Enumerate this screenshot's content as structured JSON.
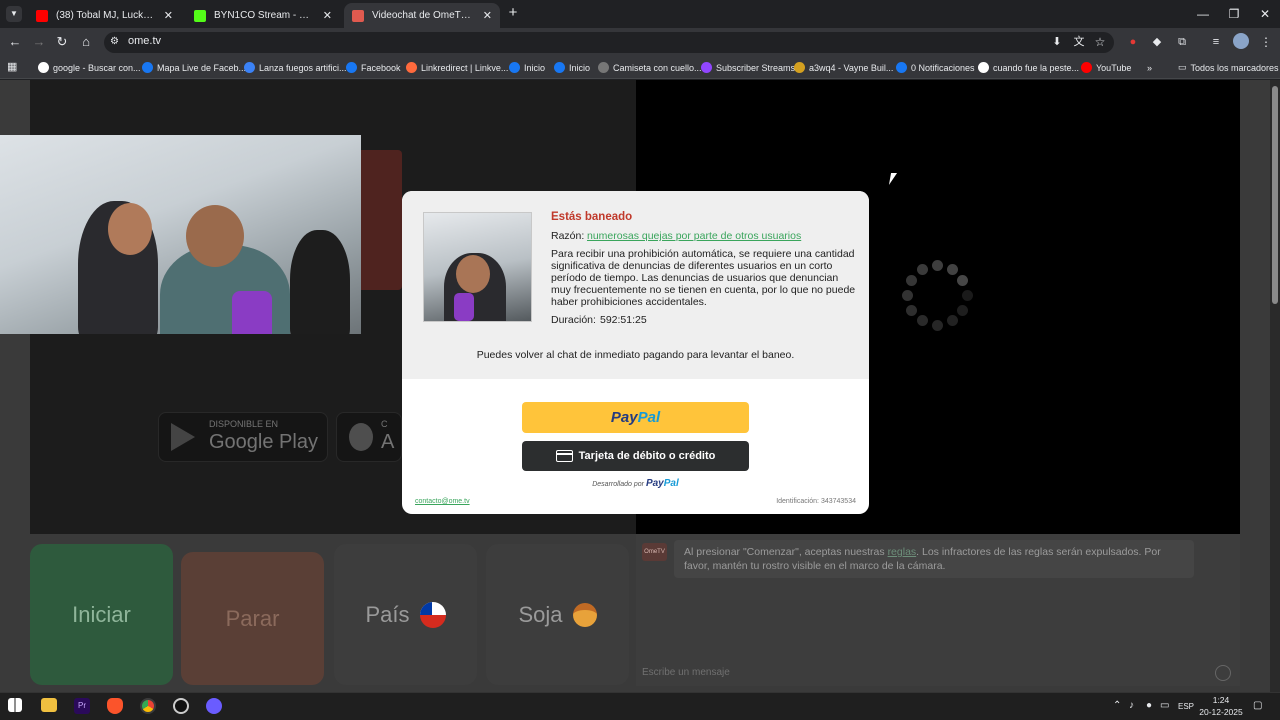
{
  "browser": {
    "tabs": [
      {
        "title": "(38) Tobal MJ, Lucky Brown - Ti",
        "icon_color": "#ff0000",
        "active": false
      },
      {
        "title": "BYN1CO Stream - Watch Live o",
        "icon_color": "#53fc18",
        "active": false
      },
      {
        "title": "Videochat de OmeTV: una alte",
        "icon_color": "#e05a4f",
        "active": true
      }
    ],
    "new_tab_symbol": "+",
    "url": "ome.tv",
    "bookmarks": [
      {
        "label": "google - Buscar con...",
        "icon": "google-icon",
        "color": "#ffffff"
      },
      {
        "label": "Mapa Live de Faceb...",
        "icon": "facebook-icon",
        "color": "#1877f2"
      },
      {
        "label": "Lanza fuegos artifici...",
        "icon": "bookmark-icon",
        "color": "#3b82f6"
      },
      {
        "label": "Facebook",
        "icon": "facebook-icon",
        "color": "#1877f2"
      },
      {
        "label": "Linkredirect | Linkve...",
        "icon": "linkvertise-icon",
        "color": "#ff6a3d"
      },
      {
        "label": "Inicio",
        "icon": "facebook-icon",
        "color": "#1877f2"
      },
      {
        "label": "Inicio",
        "icon": "facebook-icon",
        "color": "#1877f2"
      },
      {
        "label": "Camiseta con cuello...",
        "icon": "exp-icon",
        "color": "#777777"
      },
      {
        "label": "Subscriber Streams",
        "icon": "twitch-icon",
        "color": "#9146ff"
      },
      {
        "label": "a3wq4 - Vayne Buil...",
        "icon": "bookmark-icon",
        "color": "#d4a020"
      },
      {
        "label": "0 Notificaciones",
        "icon": "facebook-icon",
        "color": "#1877f2"
      },
      {
        "label": "cuando fue la peste...",
        "icon": "google-icon",
        "color": "#ffffff"
      },
      {
        "label": "YouTube",
        "icon": "youtube-icon",
        "color": "#ff0000"
      }
    ],
    "more_bookmarks": "»",
    "all_bookmarks": "Todos los marcadores"
  },
  "page": {
    "store_badges": {
      "google_play_small": "DISPONIBLE EN",
      "google_play": "Google Play",
      "apple_small": "C",
      "apple": "A"
    },
    "modal": {
      "title": "Estás baneado",
      "reason_label": "Razón:",
      "reason_value": "numerosas quejas por parte de otros usuarios",
      "description": "Para recibir una prohibición automática, se requiere una cantidad significativa de denuncias de diferentes usuarios en un corto período de tiempo. Las denuncias de usuarios que denuncian muy frecuentemente no se tienen en cuenta, por lo que no puede haber prohibiciones accidentales.",
      "duration_label": "Duración:",
      "duration_value": "592:51:25",
      "payment_note": "Puedes volver al chat de inmediato pagando para levantar el baneo.",
      "paypal_p1": "Pay",
      "paypal_p2": "Pal",
      "card_button": "Tarjeta de débito o crédito",
      "powered_by": "Desarrollado por",
      "powered_brand_1": "Pay",
      "powered_brand_2": "Pal",
      "contact": "contacto@ome.tv",
      "identification": "Identificación: 343743534"
    },
    "controls": {
      "start": "Iniciar",
      "stop": "Parar",
      "country": "País",
      "gender": "Soja"
    },
    "chat": {
      "avatar_text": "OmeTV",
      "message_before": "Al presionar \"Comenzar\", aceptas nuestras ",
      "message_link": "reglas",
      "message_after": ". Los infractores de las reglas serán expulsados. Por favor, mantén tu rostro visible en el marco de la cámara.",
      "input_placeholder": "Escribe un mensaje"
    }
  },
  "taskbar": {
    "time": "1:24",
    "date": "20-12-2025",
    "language": "ESP"
  }
}
